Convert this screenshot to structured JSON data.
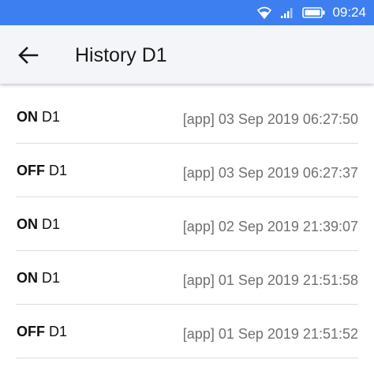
{
  "status_bar": {
    "time": "09:24",
    "icons": [
      "wifi-icon",
      "signal-icon",
      "battery-icon"
    ],
    "color": "#3d7ff1"
  },
  "app_bar": {
    "back_icon": "arrow-left-icon",
    "title": "History D1"
  },
  "history": [
    {
      "state": "ON",
      "device": "D1",
      "timestamp": "[app] 03 Sep 2019 06:27:50"
    },
    {
      "state": "OFF",
      "device": "D1",
      "timestamp": "[app] 03 Sep 2019 06:27:37"
    },
    {
      "state": "ON",
      "device": "D1",
      "timestamp": "[app] 02 Sep 2019 21:39:07"
    },
    {
      "state": "ON",
      "device": "D1",
      "timestamp": "[app] 01 Sep 2019 21:51:58"
    },
    {
      "state": "OFF",
      "device": "D1",
      "timestamp": "[app] 01 Sep 2019 21:51:52"
    }
  ]
}
